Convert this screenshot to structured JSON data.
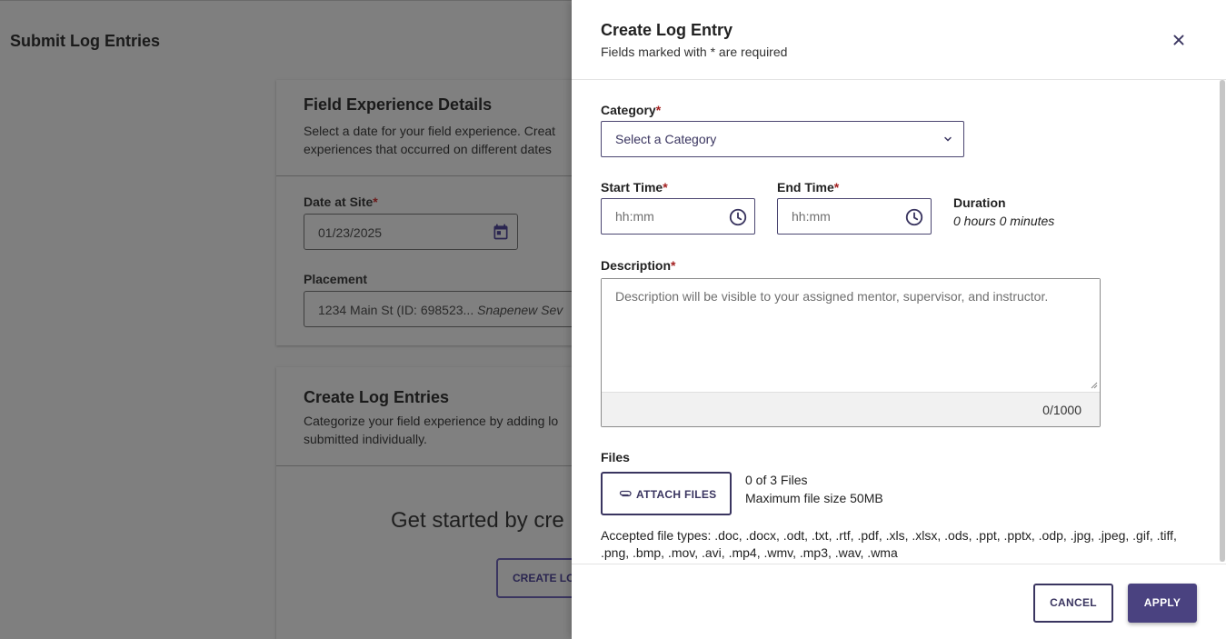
{
  "background": {
    "header_title": "Submit Log Entries",
    "field_card": {
      "title": "Field Experience Details",
      "description_line1": "Select a date for your field experience. Creat",
      "description_line2": "experiences that occurred on different dates",
      "date_label": "Date at Site",
      "date_required": "*",
      "date_value": "01/23/2025",
      "placement_label": "Placement",
      "placement_value": "1234 Main St (ID: 698523...",
      "placement_school": "Snapenew Sev"
    },
    "log_card": {
      "title": "Create Log Entries",
      "description_line1": "Categorize your field experience by adding lo",
      "description_line2": "submitted individually.",
      "empty_text": "Get started by cre",
      "create_button": "CREATE LO"
    }
  },
  "drawer": {
    "title": "Create Log Entry",
    "subtitle": "Fields marked with * are required",
    "category_label": "Category",
    "required_mark": "*",
    "category_placeholder": "Select a Category",
    "start_time_label": "Start Time",
    "start_time_placeholder": "hh:mm",
    "end_time_label": "End Time",
    "end_time_placeholder": "hh:mm",
    "duration_label": "Duration",
    "duration_value": "0 hours 0 minutes",
    "description_label": "Description",
    "description_placeholder": "Description will be visible to your assigned mentor, supervisor, and instructor.",
    "description_counter": "0/1000",
    "files_label": "Files",
    "attach_button": "ATTACH FILES",
    "files_count": "0 of 3 Files",
    "max_file_size": "Maximum file size 50MB",
    "accepted_types": "Accepted file types: .doc, .docx, .odt, .txt, .rtf, .pdf, .xls, .xlsx, .ods, .ppt, .pptx, .odp, .jpg, .jpeg, .gif, .tiff, .png, .bmp, .mov, .avi, .mp4, .wmv, .mp3, .wav, .wma",
    "cancel_button": "CANCEL",
    "apply_button": "APPLY"
  },
  "colors": {
    "accent": "#4a4280",
    "required": "#a31f1f",
    "overlay": "#808080"
  },
  "icons": [
    "calendar-icon",
    "close-icon",
    "chevron-down-icon",
    "clock-icon",
    "paperclip-icon",
    "resize-grip-icon"
  ]
}
